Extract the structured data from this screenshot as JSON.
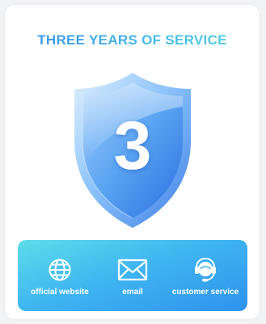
{
  "header": {
    "title": "THREE YEARS OF SERVICE"
  },
  "badge": {
    "number": "3",
    "icon": "shield-icon"
  },
  "services": [
    {
      "label": "official website",
      "icon": "globe-icon"
    },
    {
      "label": "email",
      "icon": "envelope-icon"
    },
    {
      "label": "customer service",
      "icon": "headset-icon"
    }
  ],
  "colors": {
    "accent": "#3fa9e8",
    "bar_start": "#5fdcea",
    "bar_end": "#2f93ee",
    "shield": "#5aa4f2"
  }
}
